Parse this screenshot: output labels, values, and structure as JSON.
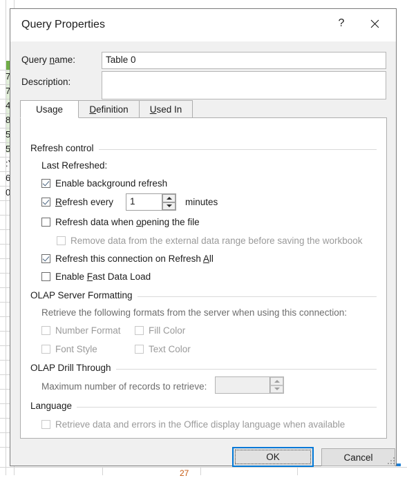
{
  "background": {
    "app": "excel-worksheet",
    "left_column_values": [
      "7",
      "7",
      "4",
      "8",
      "5",
      "5",
      ":Y",
      "6",
      "0"
    ],
    "bottom_cell_value": "27"
  },
  "dialog": {
    "title": "Query Properties",
    "help_icon": "question-mark-icon",
    "close_icon": "close-icon",
    "fields": [
      {
        "label": "Query name:",
        "mnemonic": "n",
        "value": "Table 0",
        "placeholder": ""
      },
      {
        "label": "Description:",
        "mnemonic": "",
        "value": "",
        "placeholder": ""
      }
    ],
    "tabs": [
      {
        "label": "Usage",
        "mnemonic": "g",
        "active": true
      },
      {
        "label": "Definition",
        "mnemonic": "D",
        "active": false
      },
      {
        "label": "Used In",
        "mnemonic": "U",
        "active": false
      }
    ],
    "groups": {
      "refresh_control": {
        "title": "Refresh control",
        "last_refreshed_label": "Last Refreshed:",
        "minutes_label": "minutes",
        "refresh_every_value": "1",
        "checkboxes": [
          {
            "label": "Enable background refresh",
            "mnemonic": "g",
            "checked": true,
            "disabled": false
          },
          {
            "label": "Refresh every",
            "mnemonic": "R",
            "checked": true,
            "disabled": false
          },
          {
            "label": "Refresh data when opening the file",
            "mnemonic": "o",
            "checked": false,
            "disabled": false
          },
          {
            "label": "Remove data from the external data range before saving the workbook",
            "mnemonic": "",
            "checked": false,
            "disabled": true
          },
          {
            "label": "Refresh this connection on Refresh All",
            "mnemonic": "A",
            "checked": true,
            "disabled": false
          },
          {
            "label": "Enable Fast Data Load",
            "mnemonic": "F",
            "checked": false,
            "disabled": false
          }
        ]
      },
      "olap_server_formatting": {
        "title": "OLAP Server Formatting",
        "description": "Retrieve the following formats from the server when using this connection:",
        "checkboxes": [
          {
            "label": "Number Format",
            "checked": false,
            "disabled": true
          },
          {
            "label": "Fill Color",
            "checked": false,
            "disabled": true
          },
          {
            "label": "Font Style",
            "checked": false,
            "disabled": true
          },
          {
            "label": "Text Color",
            "checked": false,
            "disabled": true
          }
        ]
      },
      "olap_drill_through": {
        "title": "OLAP Drill Through",
        "max_records_label": "Maximum number of records to retrieve:",
        "max_records_value": "",
        "disabled": true
      },
      "language": {
        "title": "Language",
        "checkboxes": [
          {
            "label": "Retrieve data and errors in the Office display language when available",
            "checked": false,
            "disabled": true
          }
        ]
      }
    },
    "footer": {
      "ok_label": "OK",
      "cancel_label": "Cancel"
    }
  }
}
